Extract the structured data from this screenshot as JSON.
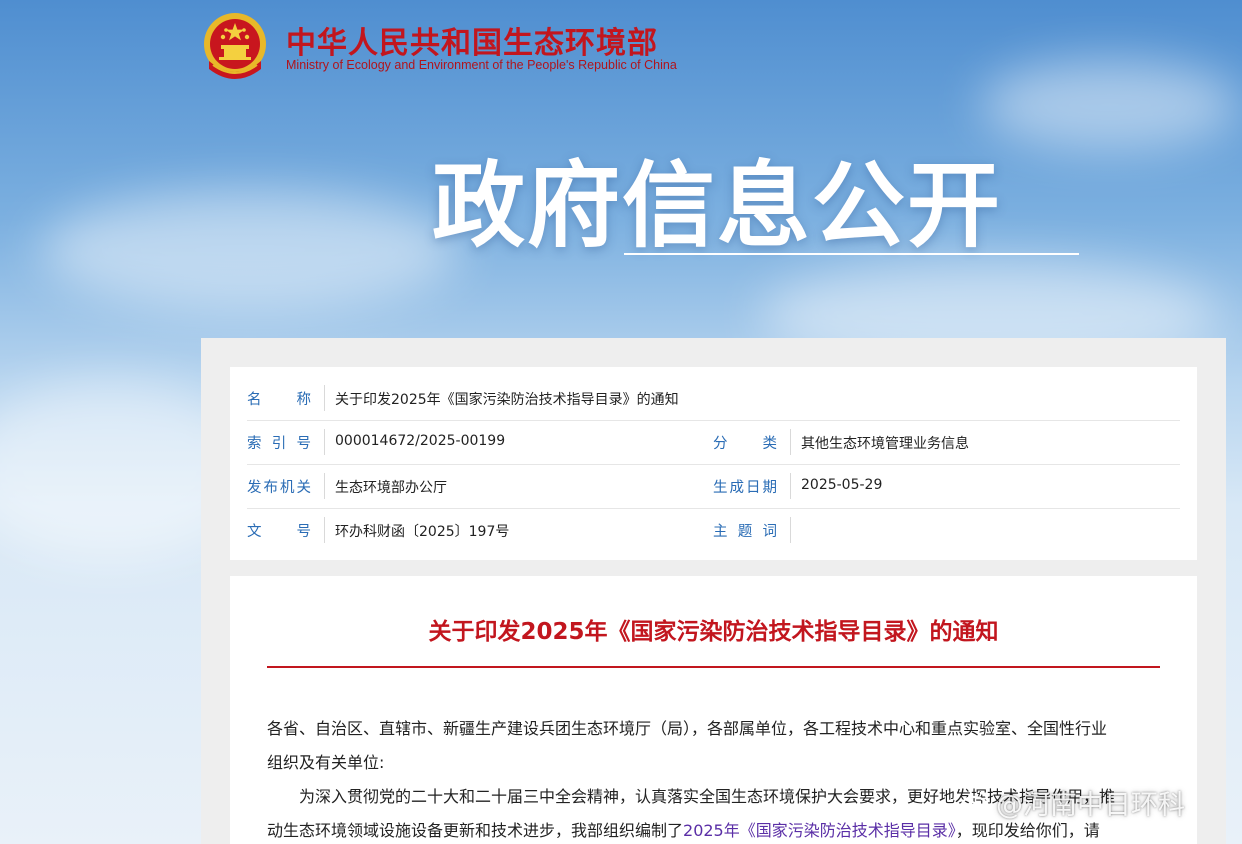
{
  "header": {
    "site_name_cn": "中华人民共和国生态环境部",
    "site_name_en": "Ministry of Ecology and Environment of the People's Republic of China",
    "emblem_icon": "national-emblem-icon",
    "section_title": "政府信息公开"
  },
  "colors": {
    "brand_red": "#c2161e",
    "label_blue": "#2a6cb5",
    "link_purple": "#5a2ea6"
  },
  "meta": {
    "name_label": "名　　称",
    "name_value": "关于印发2025年《国家污染防治技术指导目录》的通知",
    "index_label": "索 引 号",
    "index_value": "000014672/2025-00199",
    "category_label": "分　　类",
    "category_value": "其他生态环境管理业务信息",
    "issuer_label": "发布机关",
    "issuer_value": "生态环境部办公厅",
    "date_label": "生成日期",
    "date_value": "2025-05-29",
    "docno_label": "文　　号",
    "docno_value": "环办科财函〔2025〕197号",
    "subject_label": "主 题 词",
    "subject_value": ""
  },
  "article": {
    "title": "关于印发2025年《国家污染防治技术指导目录》的通知",
    "salutation_line1": "各省、自治区、直辖市、新疆生产建设兵团生态环境厅（局），各部属单位，各工程技术中心和重点实验室、全国性行业",
    "salutation_line2": "组织及有关单位:",
    "body_line1": "为深入贯彻党的二十大和二十届三中全会精神，认真落实全国生态环境保护大会要求，更好地发挥技术指导作用，推",
    "body_line2_pre": "动生态环境领域设施设备更新和技术进步，我部组织编制了",
    "body_line2_link": "2025年《国家污染防治技术指导目录》",
    "body_line2_post": "，现印发给你们，请"
  },
  "watermark": {
    "text": "@河南中日环科",
    "icon": "weibo-logo-icon"
  }
}
